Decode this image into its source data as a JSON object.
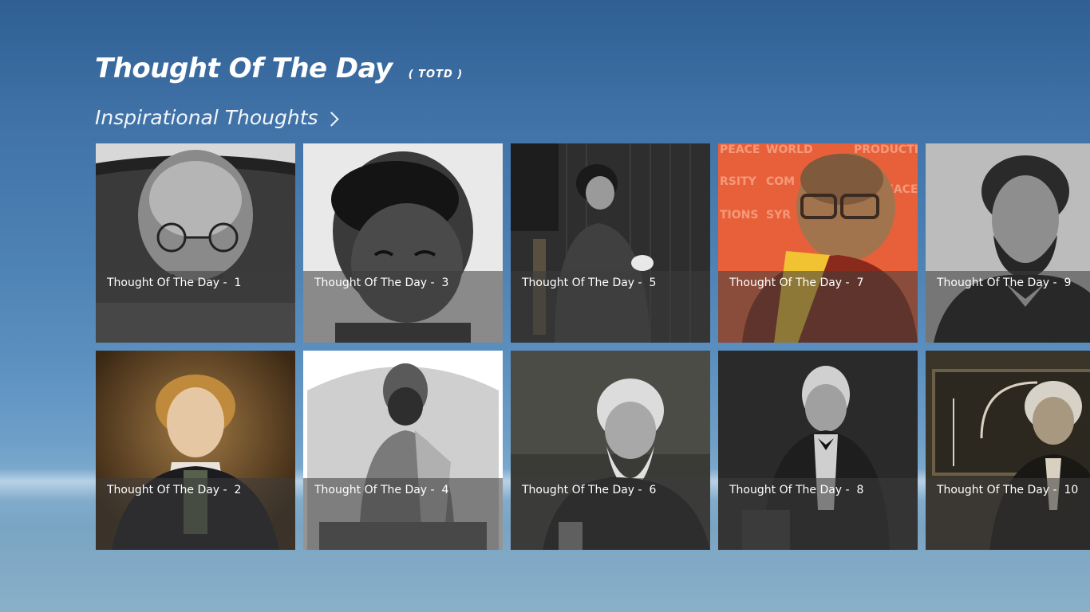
{
  "app": {
    "title": "Thought Of The Day",
    "subtitle": "( TOTD )"
  },
  "section": {
    "label": "Inspirational Thoughts",
    "icon": "chevron-right-icon"
  },
  "tiles": [
    {
      "caption": "Thought Of The Day -  1",
      "tone": "bw"
    },
    {
      "caption": "Thought Of The Day -  2",
      "tone": "color-warm"
    },
    {
      "caption": "Thought Of The Day -  3",
      "tone": "bw-light"
    },
    {
      "caption": "Thought Of The Day -  4",
      "tone": "bw-light"
    },
    {
      "caption": "Thought Of The Day -  5",
      "tone": "bw-dark"
    },
    {
      "caption": "Thought Of The Day -  6",
      "tone": "bw-dark"
    },
    {
      "caption": "Thought Of The Day -  7",
      "tone": "color-orange"
    },
    {
      "caption": "Thought Of The Day -  8",
      "tone": "bw-dark"
    },
    {
      "caption": "Thought Of The Day -  9",
      "tone": "bw"
    },
    {
      "caption": "Thought Of The Day -  10",
      "tone": "sepia"
    }
  ],
  "colors": {
    "background_top": "#2f5f93",
    "background_bottom": "#8ab0c9",
    "caption_overlay": "rgba(60,60,60,0.55)"
  }
}
